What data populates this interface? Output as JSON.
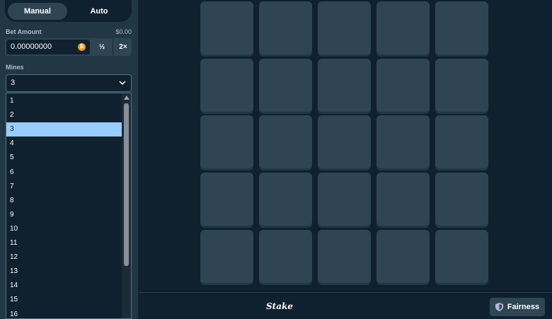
{
  "tabs": {
    "manual": "Manual",
    "auto": "Auto"
  },
  "bet": {
    "label": "Bet Amount",
    "usd_value": "$0.00",
    "amount": "0.00000000",
    "coin_symbol": "₿",
    "half_label": "½",
    "double_label": "2×"
  },
  "mines": {
    "label": "Mines",
    "selected": "3",
    "options": [
      "1",
      "2",
      "3",
      "4",
      "5",
      "6",
      "7",
      "8",
      "9",
      "10",
      "11",
      "12",
      "13",
      "14",
      "15",
      "16"
    ],
    "selected_index": 2
  },
  "footer": {
    "logo": "Stake",
    "fairness_label": "Fairness"
  },
  "colors": {
    "background": "#0f212e",
    "sidebar": "#213743",
    "tile": "#2f4553",
    "selected_option": "#99ccff"
  },
  "icons": {
    "coin": "bitcoin-icon",
    "chevron": "chevron-down-icon",
    "shield": "shield-icon"
  }
}
